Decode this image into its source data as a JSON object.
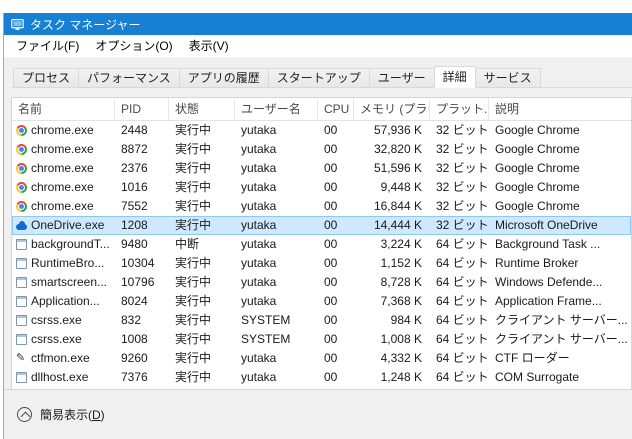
{
  "colors": {
    "titlebar": "#1880d2",
    "selection_bg": "#cde8ff",
    "selection_border": "#8ec8f2",
    "onedrive_blue": "#0d6cd0",
    "chrome_red": "#e5493a",
    "chrome_green": "#28a34c",
    "chrome_yellow": "#fcc934",
    "chrome_blue": "#4285f4"
  },
  "window": {
    "title": "タスク マネージャー"
  },
  "menubar": {
    "items": [
      "ファイル(F)",
      "オプション(O)",
      "表示(V)"
    ]
  },
  "tabs": [
    "プロセス",
    "パフォーマンス",
    "アプリの履歴",
    "スタートアップ",
    "ユーザー",
    "詳細",
    "サービス"
  ],
  "active_tab": "詳細",
  "table": {
    "columns": [
      "名前",
      "PID",
      "状態",
      "ユーザー名",
      "CPU",
      "メモリ (プライ...",
      "プラット...",
      "説明"
    ],
    "rows": [
      {
        "icon": "chrome",
        "name": "chrome.exe",
        "pid": "2448",
        "status": "実行中",
        "user": "yutaka",
        "cpu": "00",
        "memory": "57,936 K",
        "platform": "32 ビット",
        "description": "Google Chrome",
        "selected": false
      },
      {
        "icon": "chrome",
        "name": "chrome.exe",
        "pid": "8872",
        "status": "実行中",
        "user": "yutaka",
        "cpu": "00",
        "memory": "32,820 K",
        "platform": "32 ビット",
        "description": "Google Chrome",
        "selected": false
      },
      {
        "icon": "chrome",
        "name": "chrome.exe",
        "pid": "2376",
        "status": "実行中",
        "user": "yutaka",
        "cpu": "00",
        "memory": "51,596 K",
        "platform": "32 ビット",
        "description": "Google Chrome",
        "selected": false
      },
      {
        "icon": "chrome",
        "name": "chrome.exe",
        "pid": "1016",
        "status": "実行中",
        "user": "yutaka",
        "cpu": "00",
        "memory": "9,448 K",
        "platform": "32 ビット",
        "description": "Google Chrome",
        "selected": false
      },
      {
        "icon": "chrome",
        "name": "chrome.exe",
        "pid": "7552",
        "status": "実行中",
        "user": "yutaka",
        "cpu": "00",
        "memory": "16,844 K",
        "platform": "32 ビット",
        "description": "Google Chrome",
        "selected": false
      },
      {
        "icon": "onedrive",
        "name": "OneDrive.exe",
        "pid": "1208",
        "status": "実行中",
        "user": "yutaka",
        "cpu": "00",
        "memory": "14,444 K",
        "platform": "32 ビット",
        "description": "Microsoft OneDrive",
        "selected": true
      },
      {
        "icon": "window",
        "name": "backgroundT...",
        "pid": "9480",
        "status": "中断",
        "user": "yutaka",
        "cpu": "00",
        "memory": "3,224 K",
        "platform": "64 ビット",
        "description": "Background Task ...",
        "selected": false
      },
      {
        "icon": "window",
        "name": "RuntimeBro...",
        "pid": "10304",
        "status": "実行中",
        "user": "yutaka",
        "cpu": "00",
        "memory": "1,152 K",
        "platform": "64 ビット",
        "description": "Runtime Broker",
        "selected": false
      },
      {
        "icon": "window",
        "name": "smartscreen...",
        "pid": "10796",
        "status": "実行中",
        "user": "yutaka",
        "cpu": "00",
        "memory": "8,728 K",
        "platform": "64 ビット",
        "description": "Windows Defende...",
        "selected": false
      },
      {
        "icon": "window",
        "name": "Application...",
        "pid": "8024",
        "status": "実行中",
        "user": "yutaka",
        "cpu": "00",
        "memory": "7,368 K",
        "platform": "64 ビット",
        "description": "Application Frame...",
        "selected": false
      },
      {
        "icon": "window",
        "name": "csrss.exe",
        "pid": "832",
        "status": "実行中",
        "user": "SYSTEM",
        "cpu": "00",
        "memory": "984 K",
        "platform": "64 ビット",
        "description": "クライアント サーバー...",
        "selected": false
      },
      {
        "icon": "window",
        "name": "csrss.exe",
        "pid": "1008",
        "status": "実行中",
        "user": "SYSTEM",
        "cpu": "00",
        "memory": "1,008 K",
        "platform": "64 ビット",
        "description": "クライアント サーバー...",
        "selected": false
      },
      {
        "icon": "pen",
        "name": "ctfmon.exe",
        "pid": "9260",
        "status": "実行中",
        "user": "yutaka",
        "cpu": "00",
        "memory": "4,332 K",
        "platform": "64 ビット",
        "description": "CTF ローダー",
        "selected": false
      },
      {
        "icon": "window",
        "name": "dllhost.exe",
        "pid": "7376",
        "status": "実行中",
        "user": "yutaka",
        "cpu": "00",
        "memory": "1,248 K",
        "platform": "64 ビット",
        "description": "COM Surrogate",
        "selected": false
      }
    ]
  },
  "footer": {
    "label_prefix": "簡易表示(",
    "access_key": "D",
    "label_suffix": ")"
  }
}
